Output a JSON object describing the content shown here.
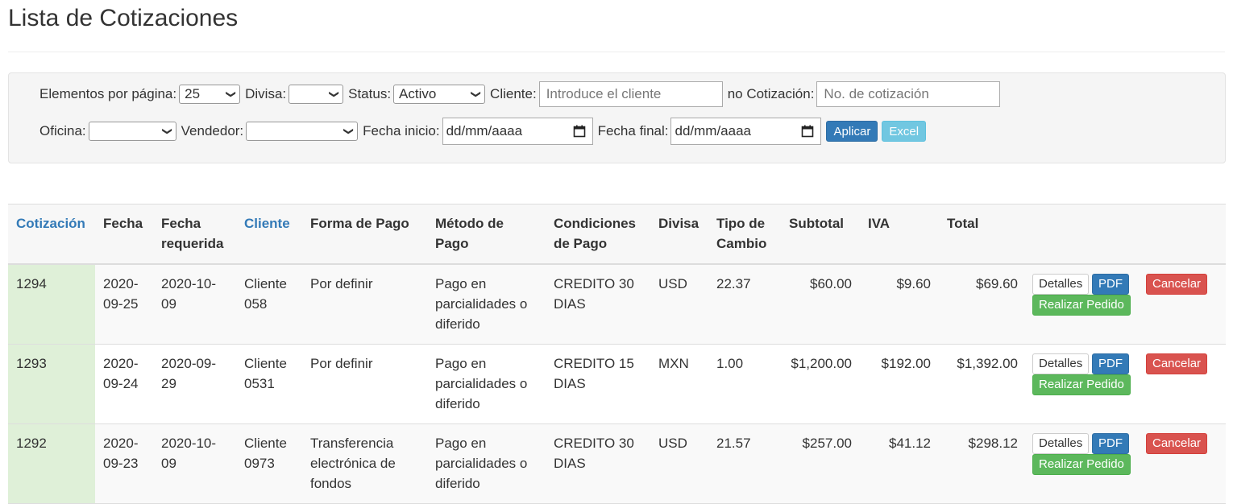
{
  "page_title": "Lista de Cotizaciones",
  "filters": {
    "per_page_label": "Elementos por página:",
    "per_page_value": "25",
    "currency_label": "Divisa:",
    "currency_value": "",
    "status_label": "Status:",
    "status_value": "Activo",
    "client_label": "Cliente:",
    "client_placeholder": "Introduce el cliente",
    "quote_no_label": "no Cotización:",
    "quote_no_placeholder": "No. de cotización",
    "office_label": "Oficina:",
    "office_value": "",
    "seller_label": "Vendedor:",
    "seller_value": "",
    "start_date_label": "Fecha inicio:",
    "start_date_value": "dd/mm/aaaa",
    "end_date_label": "Fecha final:",
    "end_date_value": "dd/mm/aaaa",
    "apply_label": "Aplicar",
    "excel_label": "Excel"
  },
  "table": {
    "headers": [
      "Cotización",
      "Fecha",
      "Fecha requerida",
      "Cliente",
      "Forma de Pago",
      "Método de Pago",
      "Condiciones de Pago",
      "Divisa",
      "Tipo de Cambio",
      "Subtotal",
      "IVA",
      "Total"
    ],
    "actions": {
      "details_label": "Detalles",
      "pdf_label": "PDF",
      "order_label": "Realizar Pedido",
      "cancel_label": "Cancelar"
    },
    "rows": [
      [
        "1294",
        "2020-09-25",
        "2020-10-09",
        "Cliente 058",
        "Por definir",
        "Pago en parcialidades o diferido",
        "CREDITO 30 DIAS",
        "USD",
        "22.37",
        "$60.00",
        "$9.60",
        "$69.60"
      ],
      [
        "1293",
        "2020-09-24",
        "2020-09-29",
        "Cliente 0531",
        "Por definir",
        "Pago en parcialidades o diferido",
        "CREDITO 15 DIAS",
        "MXN",
        "1.00",
        "$1,200.00",
        "$192.00",
        "$1,392.00"
      ],
      [
        "1292",
        "2020-09-23",
        "2020-10-09",
        "Cliente 0973",
        "Transferencia electrónica de fondos",
        "Pago en parcialidades o diferido",
        "CREDITO 30 DIAS",
        "USD",
        "21.57",
        "$257.00",
        "$41.12",
        "$298.12"
      ]
    ]
  },
  "colors": {
    "primary": "#337ab7",
    "info": "#5bc0de",
    "success": "#5cb85c",
    "danger": "#d9534f",
    "active_cell": "#dff0d8"
  }
}
